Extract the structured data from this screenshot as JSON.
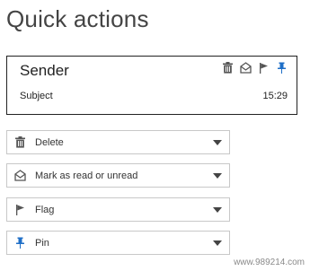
{
  "page": {
    "title": "Quick actions"
  },
  "preview": {
    "sender": "Sender",
    "subject": "Subject",
    "time": "15:29",
    "icons": [
      "trash-icon",
      "envelope-open-icon",
      "flag-icon",
      "pin-icon"
    ],
    "accent_color": "#1f6fc7"
  },
  "actions": [
    {
      "label": "Delete",
      "icon": "trash-icon"
    },
    {
      "label": "Mark as read or unread",
      "icon": "envelope-open-icon"
    },
    {
      "label": "Flag",
      "icon": "flag-icon"
    },
    {
      "label": "Pin",
      "icon": "pin-icon"
    }
  ],
  "watermark": "www.989214.com"
}
